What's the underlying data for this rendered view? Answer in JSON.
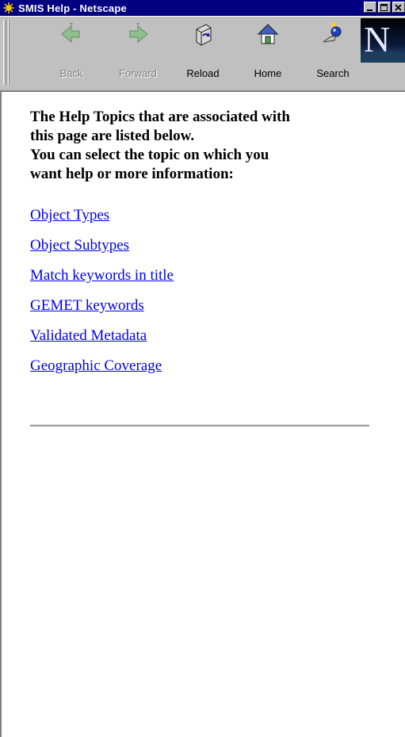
{
  "window": {
    "title": "SMIS Help - Netscape"
  },
  "toolbar": {
    "buttons": [
      {
        "label": "Back",
        "icon": "back-arrow-icon",
        "enabled": false
      },
      {
        "label": "Forward",
        "icon": "forward-arrow-icon",
        "enabled": false
      },
      {
        "label": "Reload",
        "icon": "reload-icon",
        "enabled": true
      },
      {
        "label": "Home",
        "icon": "home-icon",
        "enabled": true
      },
      {
        "label": "Search",
        "icon": "search-icon",
        "enabled": true
      }
    ],
    "brand_letter": "N"
  },
  "content": {
    "intro_lines": [
      "The Help Topics that are associated with",
      "this page are listed below.",
      "You can select the topic on which you",
      "want help or more information:"
    ],
    "links": [
      "Object Types",
      "Object Subtypes",
      "Match keywords in title",
      "GEMET keywords",
      "Validated Metadata",
      "Geographic Coverage"
    ]
  },
  "colors": {
    "titlebar": "#000080",
    "link": "#0000ee",
    "chrome": "#c0c0c0"
  }
}
